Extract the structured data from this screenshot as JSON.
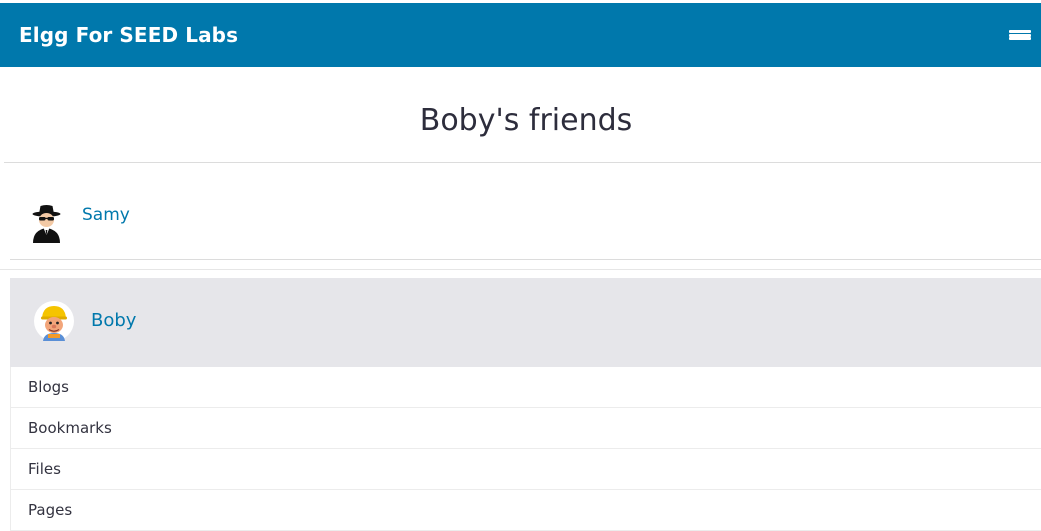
{
  "header": {
    "site_name": "Elgg For SEED Labs",
    "menu_icon": "hamburger-menu-icon",
    "brand_color": "#0078ac"
  },
  "page": {
    "title": "Boby's friends"
  },
  "friends": [
    {
      "name": "Samy",
      "avatar": "spy-avatar"
    }
  ],
  "owner": {
    "name": "Boby",
    "avatar": "builder-avatar",
    "menu": [
      {
        "label": "Blogs"
      },
      {
        "label": "Bookmarks"
      },
      {
        "label": "Files"
      },
      {
        "label": "Pages"
      }
    ]
  }
}
